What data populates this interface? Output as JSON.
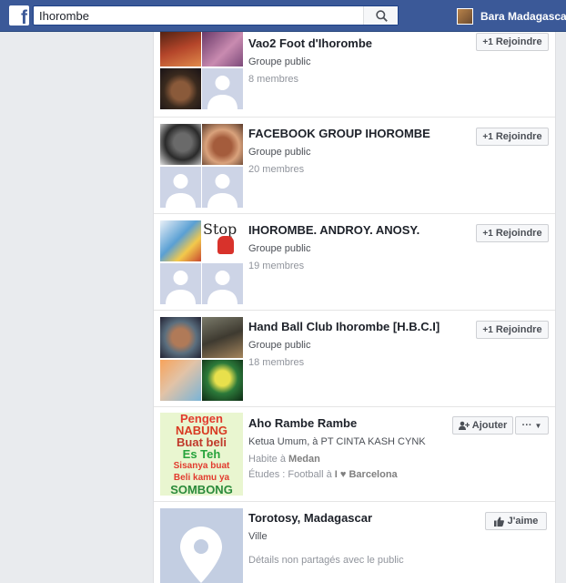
{
  "topbar": {
    "logo": "f",
    "search_value": "Ihorombe",
    "user_name": "Bara Madagascar"
  },
  "results": [
    {
      "title": "Vao2 Foot d'Ihorombe",
      "subtitle": "Groupe public",
      "meta": "8 membres",
      "action": "Rejoindre",
      "action_icon": "+1"
    },
    {
      "title": "FACEBOOK GROUP IHOROMBE",
      "subtitle": "Groupe public",
      "meta": "20 membres",
      "action": "Rejoindre",
      "action_icon": "+1"
    },
    {
      "title": "IHOROMBE. ANDROY. ANOSY.",
      "subtitle": "Groupe public",
      "meta": "19 membres",
      "action": "Rejoindre",
      "action_icon": "+1",
      "thumb_text": "Stop"
    },
    {
      "title": "Hand Ball Club Ihorombe [H.B.C.I]",
      "subtitle": "Groupe public",
      "meta": "18 membres",
      "action": "Rejoindre",
      "action_icon": "+1"
    },
    {
      "title": "Aho Rambe Rambe",
      "subtitle": "Ketua Umum, à PT CINTA KASH CYNK",
      "lives_prefix": "Habite à ",
      "lives_place": "Medan",
      "studies_prefix": "Études : Football à ",
      "studies_place": "I ♥ Barcelona",
      "action": "Ajouter",
      "more": "···",
      "thumb_lines": [
        "Pengen",
        "NABUNG",
        "Buat beli",
        "Es Teh",
        "Sisanya buat",
        "Beli kamu ya",
        "SOMBONG"
      ]
    },
    {
      "title": "Torotosy, Madagascar",
      "subtitle": "Ville",
      "meta": "Détails non partagés avec le public",
      "action": "J'aime"
    }
  ],
  "colors": {
    "brand": "#3b5998",
    "placeholder": "#cdd4e6"
  }
}
